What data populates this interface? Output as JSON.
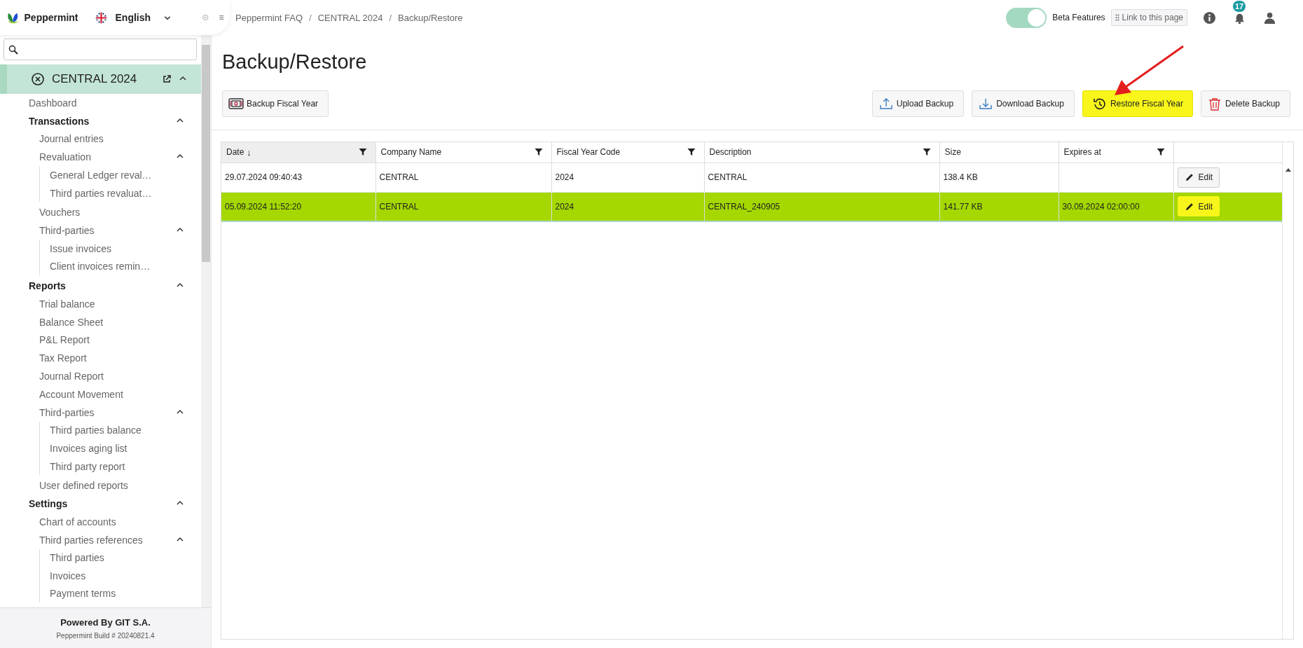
{
  "app": {
    "name": "Peppermint",
    "language": "English"
  },
  "breadcrumb": [
    {
      "kind": "link",
      "label": "Peppermint FAQ"
    },
    {
      "kind": "separator",
      "label": "/"
    },
    {
      "kind": "link",
      "label": "CENTRAL 2024"
    },
    {
      "kind": "separator",
      "label": "/"
    },
    {
      "kind": "link",
      "label": "Backup/Restore"
    }
  ],
  "topbar": {
    "beta_toggle": {
      "label": "Beta Features",
      "on": true
    },
    "link_button": "Link to this page",
    "notifications": "17"
  },
  "sidebar": {
    "company": {
      "label": "CENTRAL 2024",
      "expanded": true
    },
    "items": [
      {
        "label": "Dashboard",
        "kind": "link"
      },
      {
        "label": "Transactions",
        "kind": "section",
        "expanded": true,
        "children": [
          {
            "label": "Journal entries",
            "kind": "link"
          },
          {
            "label": "Revaluation",
            "kind": "link",
            "expanded": true,
            "children": [
              {
                "label": "General Ledger reval…",
                "kind": "link"
              },
              {
                "label": "Third parties revaluat…",
                "kind": "link"
              }
            ]
          },
          {
            "label": "Vouchers",
            "kind": "link"
          },
          {
            "label": "Third-parties",
            "kind": "link",
            "expanded": true,
            "children": [
              {
                "label": "Issue invoices",
                "kind": "link"
              },
              {
                "label": "Client invoices remin…",
                "kind": "link"
              }
            ]
          }
        ]
      },
      {
        "label": "Reports",
        "kind": "section",
        "expanded": true,
        "children": [
          {
            "label": "Trial balance",
            "kind": "link"
          },
          {
            "label": "Balance Sheet",
            "kind": "link"
          },
          {
            "label": "P&L Report",
            "kind": "link"
          },
          {
            "label": "Tax Report",
            "kind": "link"
          },
          {
            "label": "Journal Report",
            "kind": "link"
          },
          {
            "label": "Account Movement",
            "kind": "link"
          },
          {
            "label": "Third-parties",
            "kind": "link",
            "expanded": true,
            "children": [
              {
                "label": "Third parties balance",
                "kind": "link"
              },
              {
                "label": "Invoices aging list",
                "kind": "link"
              },
              {
                "label": "Third party report",
                "kind": "link"
              }
            ]
          },
          {
            "label": "User defined reports",
            "kind": "link"
          }
        ]
      },
      {
        "label": "Settings",
        "kind": "section",
        "expanded": true,
        "children": [
          {
            "label": "Chart of accounts",
            "kind": "link"
          },
          {
            "label": "Third parties references",
            "kind": "link",
            "expanded": true,
            "children": [
              {
                "label": "Third parties",
                "kind": "link"
              },
              {
                "label": "Invoices",
                "kind": "link"
              },
              {
                "label": "Payment terms",
                "kind": "link"
              }
            ]
          }
        ]
      }
    ],
    "footer": {
      "powered": "Powered By GIT S.A.",
      "build": "Peppermint Build # 20240821.4"
    }
  },
  "page": {
    "title": "Backup/Restore"
  },
  "toolbar": {
    "left": [
      {
        "label": "Backup Fiscal Year",
        "highlighted": false
      }
    ],
    "right": [
      {
        "label": "Upload Backup",
        "highlighted": false
      },
      {
        "label": "Download Backup",
        "highlighted": false
      },
      {
        "label": "Restore Fiscal Year",
        "highlighted": true
      },
      {
        "label": "Delete Backup",
        "highlighted": false
      }
    ]
  },
  "table": {
    "columns": [
      {
        "label": "Date",
        "sort_mark": "↓",
        "filter": true
      },
      {
        "label": "Company Name",
        "filter": true
      },
      {
        "label": "Fiscal Year Code",
        "filter": true
      },
      {
        "label": "Description",
        "filter": true
      },
      {
        "label": "Size",
        "filter": false
      },
      {
        "label": "Expires at",
        "filter": true
      }
    ],
    "rows": [
      {
        "cells": [
          "29.07.2024 09:40:43",
          "CENTRAL",
          "2024",
          "CENTRAL",
          "138.4 KB",
          ""
        ],
        "selected": false,
        "edit": {
          "label": "Edit",
          "highlighted": false
        }
      },
      {
        "cells": [
          "05.09.2024 11:52:20",
          "CENTRAL",
          "2024",
          "CENTRAL_240905",
          "141.77 KB",
          "30.09.2024 02:00:00"
        ],
        "selected": true,
        "edit": {
          "label": "Edit",
          "highlighted": true
        }
      }
    ]
  },
  "annotation": {
    "kind": "arrow"
  }
}
